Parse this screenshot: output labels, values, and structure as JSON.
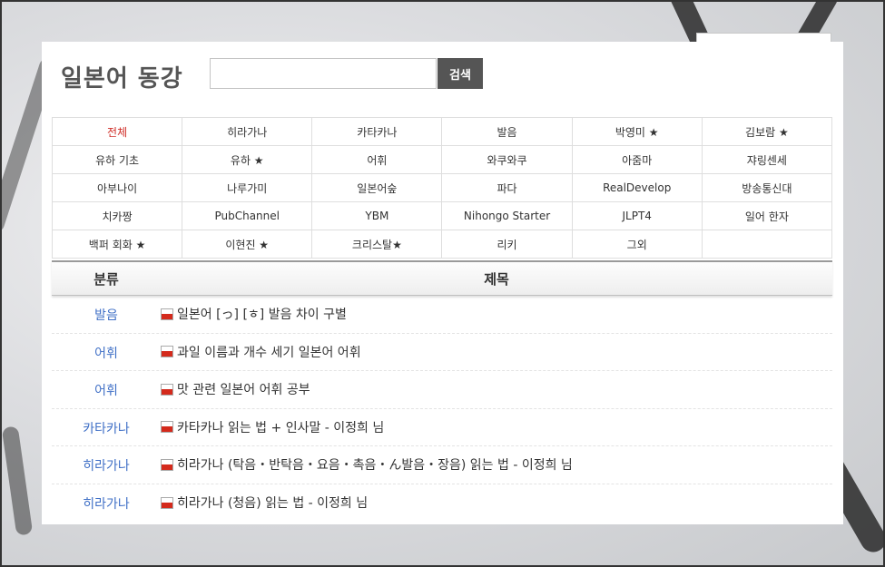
{
  "header": {
    "title": "일본어 동강",
    "search_button": "검색",
    "search_placeholder": ""
  },
  "categories": [
    [
      "전체",
      "히라가나",
      "카타카나",
      "발음",
      "박영미 ★",
      "김보람 ★"
    ],
    [
      "유하 기초",
      "유하 ★",
      "어휘",
      "와쿠와쿠",
      "아줌마",
      "쟈링센세"
    ],
    [
      "아부나이",
      "나루가미",
      "일본어숲",
      "파다",
      "RealDevelop",
      "방송통신대"
    ],
    [
      "치카짱",
      "PubChannel",
      "YBM",
      "Nihongo Starter",
      "JLPT4",
      "일어 한자"
    ],
    [
      "백퍼 회화 ★",
      "이현진 ★",
      "크리스탈★",
      "리키",
      "그외",
      ""
    ]
  ],
  "list": {
    "headers": {
      "category": "분류",
      "title": "제목"
    },
    "rows": [
      {
        "category": "발음",
        "title": "일본어 [っ] [ㅎ] 발음 차이 구별"
      },
      {
        "category": "어휘",
        "title": "과일 이름과 개수 세기 일본어 어휘"
      },
      {
        "category": "어휘",
        "title": "맛 관련 일본어 어휘 공부"
      },
      {
        "category": "카타카나",
        "title": "카타카나 읽는 법 + 인사말 - 이정희 님"
      },
      {
        "category": "히라가나",
        "title": "히라가나 (탁음・반탁음・요음・촉음・ん발음・장음) 읽는 법 - 이정희 님"
      },
      {
        "category": "히라가나",
        "title": "히라가나 (청음) 읽는 법 - 이정희 님"
      }
    ]
  },
  "colors": {
    "active": "#d0302a",
    "link": "#3f6fc6",
    "button": "#555555",
    "youtube": "#d42a1c"
  },
  "icons": {
    "video": "youtube-icon"
  }
}
